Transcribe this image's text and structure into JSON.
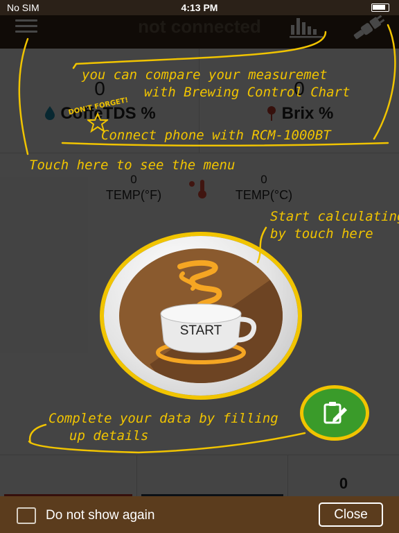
{
  "status_bar": {
    "carrier": "No SIM",
    "time": "4:13 PM"
  },
  "navbar": {
    "title": "not connected",
    "menu_icon": "hamburger-icon",
    "chart_icon": "bar-chart-icon",
    "connect_icon": "plug-icon"
  },
  "measurements": {
    "left": {
      "value": "0",
      "label": "CoffeTDS %",
      "icon": "water-drop-icon"
    },
    "right": {
      "value": "0",
      "label": "Brix %",
      "icon": "lollipop-icon"
    }
  },
  "temperature": {
    "fahrenheit": {
      "value": "0",
      "label": "TEMP(°F)"
    },
    "celsius": {
      "value": "0",
      "label": "TEMP(°C)"
    },
    "icon": "thermometer-icon"
  },
  "start_button": {
    "label": "START",
    "icon": "coffee-cup-icon"
  },
  "details_button": {
    "icon": "clipboard-edit-icon"
  },
  "bottom_row": {
    "right_value": "0"
  },
  "tutorial": {
    "compare_line1": "you can compare your measuremet",
    "compare_line2": "with Brewing Control Chart",
    "dont_forget": "DON'T FORGET!",
    "connect": "Connect phone with RCM-1000BT",
    "menu": "Touch here to see the menu",
    "start_line1": "Start calculating",
    "start_line2": "by touch here",
    "complete_line1": "Complete your data by filling",
    "complete_line2": "up details"
  },
  "footer": {
    "checkbox_label": "Do not show again",
    "close_label": "Close"
  },
  "colors": {
    "accent": "#f1c400",
    "brown": "#5b3c1d",
    "green": "#3a9b2a",
    "overlay": "rgba(0,0,0,0.72)"
  }
}
